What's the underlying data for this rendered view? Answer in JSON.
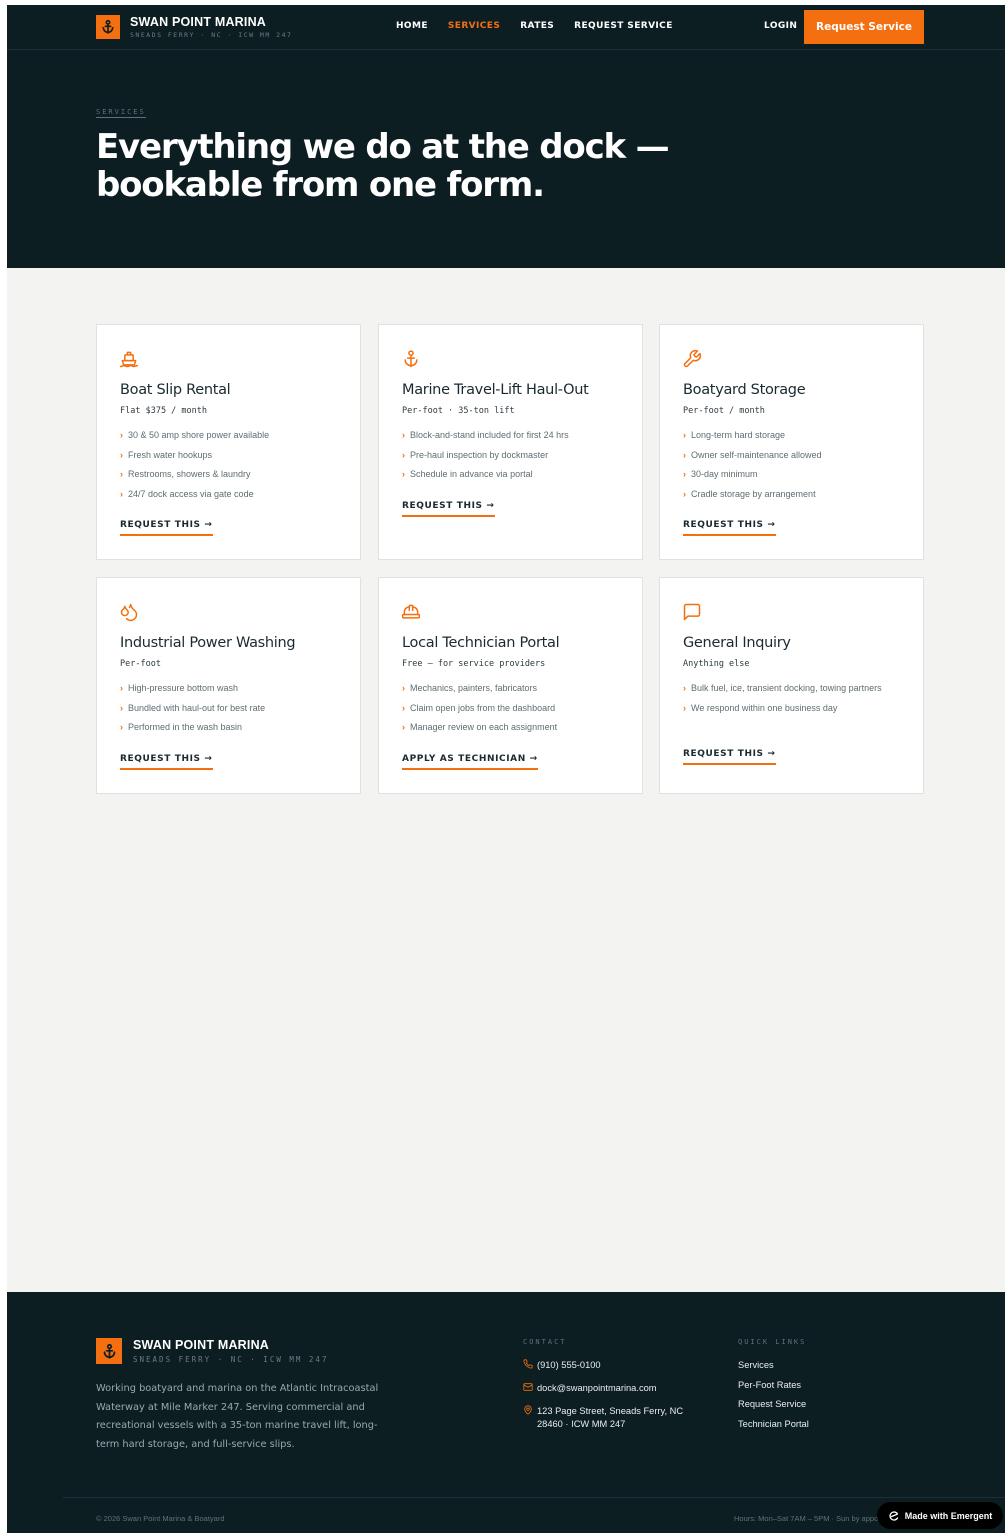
{
  "brand": {
    "name": "SWAN POINT MARINA",
    "tagline": "SNEADS FERRY · NC · ICW MM 247",
    "logo_icon": "anchor-icon",
    "accent_color": "#f36f0f",
    "dark_color": "#0d1e23"
  },
  "nav": {
    "items": [
      {
        "label": "HOME",
        "active": false
      },
      {
        "label": "SERVICES",
        "active": true
      },
      {
        "label": "RATES",
        "active": false
      },
      {
        "label": "REQUEST SERVICE",
        "active": false
      }
    ],
    "login_label": "LOGIN",
    "cta_label": "Request Service"
  },
  "hero": {
    "eyebrow": "SERVICES",
    "title": "Everything we do at the dock — bookable from one form."
  },
  "services": [
    {
      "icon": "boat-icon",
      "title": "Boat Slip Rental",
      "price": "Flat $375 / month",
      "features": [
        "30 & 50 amp shore power available",
        "Fresh water hookups",
        "Restrooms, showers & laundry",
        "24/7 dock access via gate code"
      ],
      "action": "REQUEST THIS →"
    },
    {
      "icon": "anchor-icon",
      "title": "Marine Travel-Lift Haul-Out",
      "price": "Per-foot · 35-ton lift",
      "features": [
        "Block-and-stand included for first 24 hrs",
        "Pre-haul inspection by dockmaster",
        "Schedule in advance via portal"
      ],
      "action": "REQUEST THIS →"
    },
    {
      "icon": "wrench-icon",
      "title": "Boatyard Storage",
      "price": "Per-foot / month",
      "features": [
        "Long-term hard storage",
        "Owner self-maintenance allowed",
        "30-day minimum",
        "Cradle storage by arrangement"
      ],
      "action": "REQUEST THIS →"
    },
    {
      "icon": "droplets-icon",
      "title": "Industrial Power Washing",
      "price": "Per-foot",
      "features": [
        "High-pressure bottom wash",
        "Bundled with haul-out for best rate",
        "Performed in the wash basin"
      ],
      "action": "REQUEST THIS →"
    },
    {
      "icon": "hard-hat-icon",
      "title": "Local Technician Portal",
      "price": "Free — for service providers",
      "features": [
        "Mechanics, painters, fabricators",
        "Claim open jobs from the dashboard",
        "Manager review on each assignment"
      ],
      "action": "APPLY AS TECHNICIAN →"
    },
    {
      "icon": "message-square-icon",
      "title": "General Inquiry",
      "price": "Anything else",
      "features": [
        "Bulk fuel, ice, transient docking, towing partners",
        "We respond within one business day"
      ],
      "action": "REQUEST THIS →"
    }
  ],
  "footer": {
    "description": "Working boatyard and marina on the Atlantic Intracoastal Waterway at Mile Marker 247. Serving commercial and recreational vessels with a 35-ton marine travel lift, long-term hard storage, and full-service slips.",
    "contact_heading": "CONTACT",
    "phone": "(910) 555-0100",
    "email": "dock@swanpointmarina.com",
    "address": "123 Page Street, Sneads Ferry, NC 28460 · ICW MM 247",
    "links_heading": "QUICK LINKS",
    "links": [
      "Services",
      "Per-Foot Rates",
      "Request Service",
      "Technician Portal"
    ],
    "copyright": "© 2026 Swan Point Marina & Boatyard",
    "hours": "Hours: Mon–Sat 7AM – 5PM · Sun by appointment",
    "made_with": "Made with Emergent"
  }
}
